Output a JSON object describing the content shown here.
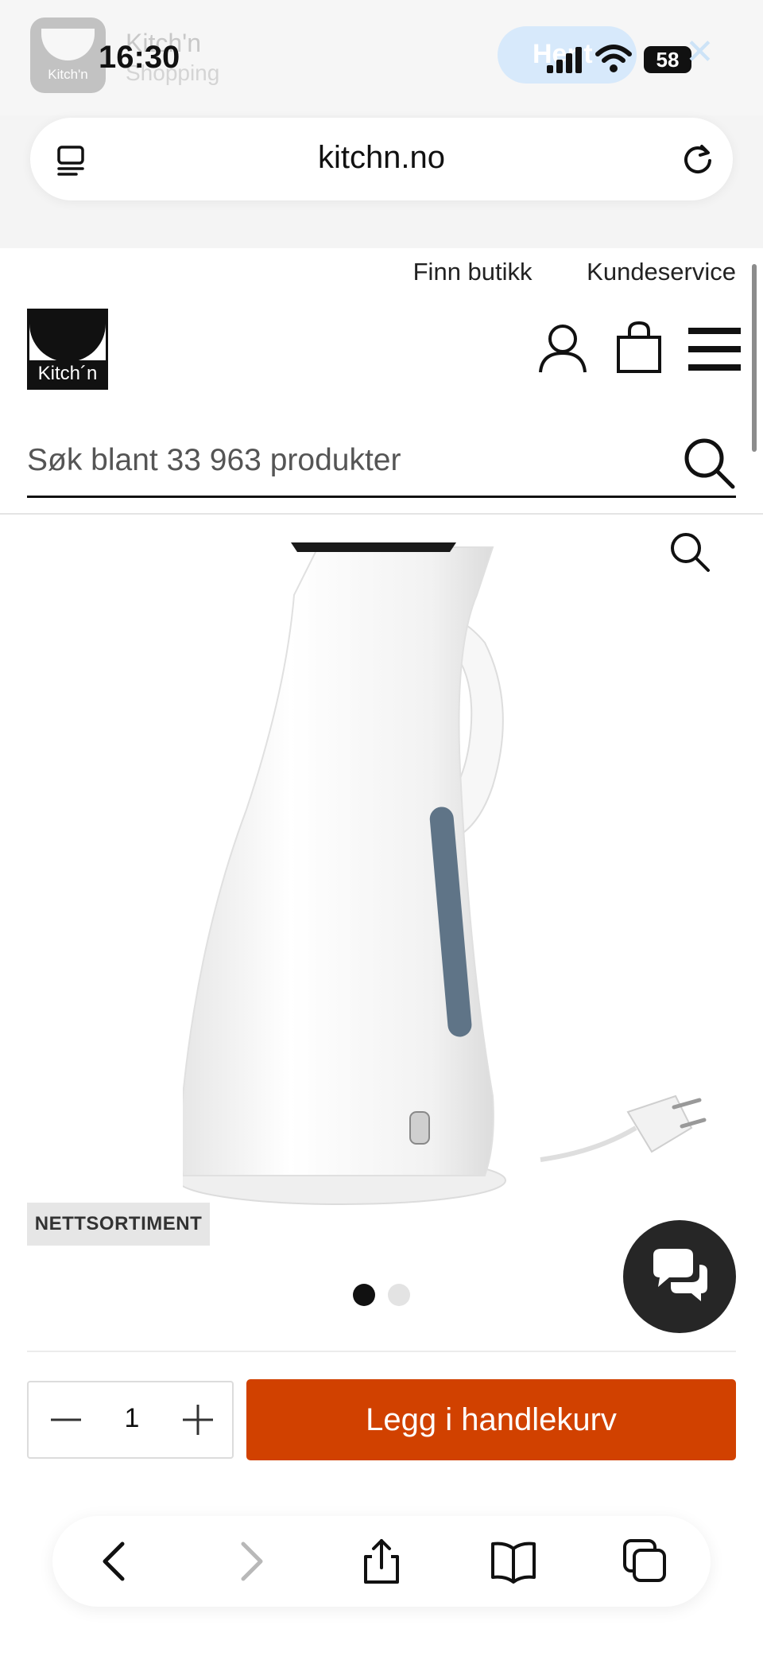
{
  "status_bar": {
    "app_icon_label": "Kitch'n",
    "ghost_title": "Kitch'n",
    "ghost_subtitle": "Shopping",
    "time": "16:30",
    "pill_label": "Hent",
    "battery": "58"
  },
  "browser": {
    "url": "kitchn.no"
  },
  "header": {
    "links": [
      "Finn butikk",
      "Kundeservice"
    ],
    "logo_text": "Kitch´n",
    "search_placeholder": "Søk blant 33 963 produkter"
  },
  "product": {
    "badge": "NETTSORTIMENT",
    "image_count": 2,
    "active_image_index": 0
  },
  "purchase": {
    "quantity": "1",
    "add_to_cart_label": "Legg i handlekurv"
  },
  "colors": {
    "accent": "#d14100",
    "chat_button": "#262626"
  },
  "icons": {
    "tabs": "tabs-icon",
    "reload": "reload-icon",
    "account": "account-icon",
    "bag": "shopping-bag-icon",
    "menu": "hamburger-menu-icon",
    "search": "search-icon",
    "zoom": "zoom-icon",
    "chat": "chat-icon",
    "back": "chevron-left-icon",
    "forward": "chevron-right-icon",
    "share": "share-icon",
    "bookmarks": "book-icon",
    "tabs_overview": "tabs-overview-icon"
  }
}
